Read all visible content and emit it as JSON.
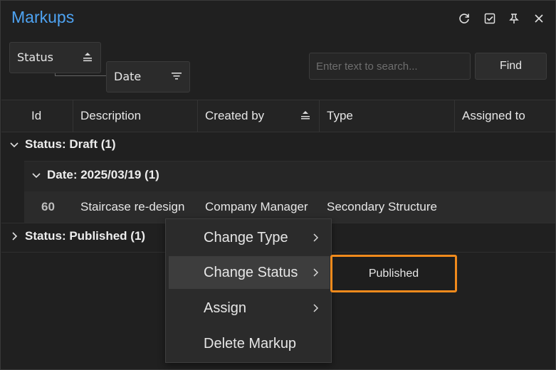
{
  "panel": {
    "title": "Markups",
    "buttons": [
      {
        "name": "refresh-icon"
      },
      {
        "name": "select-all-icon"
      },
      {
        "name": "pin-icon"
      },
      {
        "name": "close-icon"
      }
    ]
  },
  "grouping": {
    "chips": [
      {
        "label": "Status",
        "sort_icon": "sort-ascending-icon"
      },
      {
        "label": "Date",
        "sort_icon": "filter-lines-icon"
      }
    ]
  },
  "search": {
    "placeholder": "Enter text to search...",
    "value": "",
    "find_label": "Find"
  },
  "table": {
    "columns": [
      "Id",
      "Description",
      "Created by",
      "Type",
      "Assigned to"
    ],
    "sorted_column": "Created by",
    "groups": [
      {
        "label": "Status: Draft (1)",
        "expanded": true,
        "subgroups": [
          {
            "label": "Date: 2025/03/19 (1)",
            "expanded": true,
            "rows": [
              {
                "id": "60",
                "description": "Staircase re-design",
                "created_by": "Company Manager",
                "type": "Secondary Structure",
                "assigned_to": ""
              }
            ]
          }
        ]
      },
      {
        "label": "Status: Published (1)",
        "expanded": false
      }
    ]
  },
  "context_menu": {
    "items": [
      {
        "label": "Change Type",
        "has_submenu": true
      },
      {
        "label": "Change Status",
        "has_submenu": true,
        "active": true
      },
      {
        "label": "Assign",
        "has_submenu": true
      },
      {
        "label": "Delete Markup",
        "has_submenu": false
      }
    ],
    "submenu": {
      "items": [
        "Published"
      ],
      "highlight_color": "#f08a1c"
    }
  },
  "colors": {
    "title": "#4ea3f2",
    "background": "#202020",
    "highlight": "#f08a1c"
  }
}
